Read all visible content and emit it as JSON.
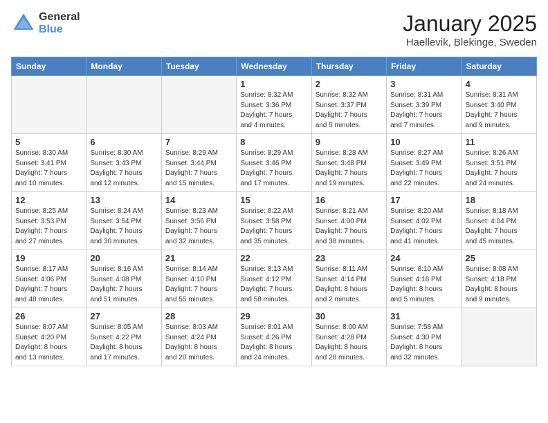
{
  "header": {
    "logo_general": "General",
    "logo_blue": "Blue",
    "month": "January 2025",
    "location": "Haellevik, Blekinge, Sweden"
  },
  "weekdays": [
    "Sunday",
    "Monday",
    "Tuesday",
    "Wednesday",
    "Thursday",
    "Friday",
    "Saturday"
  ],
  "weeks": [
    [
      {
        "day": "",
        "info": ""
      },
      {
        "day": "",
        "info": ""
      },
      {
        "day": "",
        "info": ""
      },
      {
        "day": "1",
        "info": "Sunrise: 8:32 AM\nSunset: 3:36 PM\nDaylight: 7 hours\nand 4 minutes."
      },
      {
        "day": "2",
        "info": "Sunrise: 8:32 AM\nSunset: 3:37 PM\nDaylight: 7 hours\nand 5 minutes."
      },
      {
        "day": "3",
        "info": "Sunrise: 8:31 AM\nSunset: 3:39 PM\nDaylight: 7 hours\nand 7 minutes."
      },
      {
        "day": "4",
        "info": "Sunrise: 8:31 AM\nSunset: 3:40 PM\nDaylight: 7 hours\nand 9 minutes."
      }
    ],
    [
      {
        "day": "5",
        "info": "Sunrise: 8:30 AM\nSunset: 3:41 PM\nDaylight: 7 hours\nand 10 minutes."
      },
      {
        "day": "6",
        "info": "Sunrise: 8:30 AM\nSunset: 3:43 PM\nDaylight: 7 hours\nand 12 minutes."
      },
      {
        "day": "7",
        "info": "Sunrise: 8:29 AM\nSunset: 3:44 PM\nDaylight: 7 hours\nand 15 minutes."
      },
      {
        "day": "8",
        "info": "Sunrise: 8:29 AM\nSunset: 3:46 PM\nDaylight: 7 hours\nand 17 minutes."
      },
      {
        "day": "9",
        "info": "Sunrise: 8:28 AM\nSunset: 3:48 PM\nDaylight: 7 hours\nand 19 minutes."
      },
      {
        "day": "10",
        "info": "Sunrise: 8:27 AM\nSunset: 3:49 PM\nDaylight: 7 hours\nand 22 minutes."
      },
      {
        "day": "11",
        "info": "Sunrise: 8:26 AM\nSunset: 3:51 PM\nDaylight: 7 hours\nand 24 minutes."
      }
    ],
    [
      {
        "day": "12",
        "info": "Sunrise: 8:25 AM\nSunset: 3:53 PM\nDaylight: 7 hours\nand 27 minutes."
      },
      {
        "day": "13",
        "info": "Sunrise: 8:24 AM\nSunset: 3:54 PM\nDaylight: 7 hours\nand 30 minutes."
      },
      {
        "day": "14",
        "info": "Sunrise: 8:23 AM\nSunset: 3:56 PM\nDaylight: 7 hours\nand 32 minutes."
      },
      {
        "day": "15",
        "info": "Sunrise: 8:22 AM\nSunset: 3:58 PM\nDaylight: 7 hours\nand 35 minutes."
      },
      {
        "day": "16",
        "info": "Sunrise: 8:21 AM\nSunset: 4:00 PM\nDaylight: 7 hours\nand 38 minutes."
      },
      {
        "day": "17",
        "info": "Sunrise: 8:20 AM\nSunset: 4:02 PM\nDaylight: 7 hours\nand 41 minutes."
      },
      {
        "day": "18",
        "info": "Sunrise: 8:18 AM\nSunset: 4:04 PM\nDaylight: 7 hours\nand 45 minutes."
      }
    ],
    [
      {
        "day": "19",
        "info": "Sunrise: 8:17 AM\nSunset: 4:06 PM\nDaylight: 7 hours\nand 48 minutes."
      },
      {
        "day": "20",
        "info": "Sunrise: 8:16 AM\nSunset: 4:08 PM\nDaylight: 7 hours\nand 51 minutes."
      },
      {
        "day": "21",
        "info": "Sunrise: 8:14 AM\nSunset: 4:10 PM\nDaylight: 7 hours\nand 55 minutes."
      },
      {
        "day": "22",
        "info": "Sunrise: 8:13 AM\nSunset: 4:12 PM\nDaylight: 7 hours\nand 58 minutes."
      },
      {
        "day": "23",
        "info": "Sunrise: 8:11 AM\nSunset: 4:14 PM\nDaylight: 8 hours\nand 2 minutes."
      },
      {
        "day": "24",
        "info": "Sunrise: 8:10 AM\nSunset: 4:16 PM\nDaylight: 8 hours\nand 5 minutes."
      },
      {
        "day": "25",
        "info": "Sunrise: 8:08 AM\nSunset: 4:18 PM\nDaylight: 8 hours\nand 9 minutes."
      }
    ],
    [
      {
        "day": "26",
        "info": "Sunrise: 8:07 AM\nSunset: 4:20 PM\nDaylight: 8 hours\nand 13 minutes."
      },
      {
        "day": "27",
        "info": "Sunrise: 8:05 AM\nSunset: 4:22 PM\nDaylight: 8 hours\nand 17 minutes."
      },
      {
        "day": "28",
        "info": "Sunrise: 8:03 AM\nSunset: 4:24 PM\nDaylight: 8 hours\nand 20 minutes."
      },
      {
        "day": "29",
        "info": "Sunrise: 8:01 AM\nSunset: 4:26 PM\nDaylight: 8 hours\nand 24 minutes."
      },
      {
        "day": "30",
        "info": "Sunrise: 8:00 AM\nSunset: 4:28 PM\nDaylight: 8 hours\nand 28 minutes."
      },
      {
        "day": "31",
        "info": "Sunrise: 7:58 AM\nSunset: 4:30 PM\nDaylight: 8 hours\nand 32 minutes."
      },
      {
        "day": "",
        "info": ""
      }
    ]
  ]
}
